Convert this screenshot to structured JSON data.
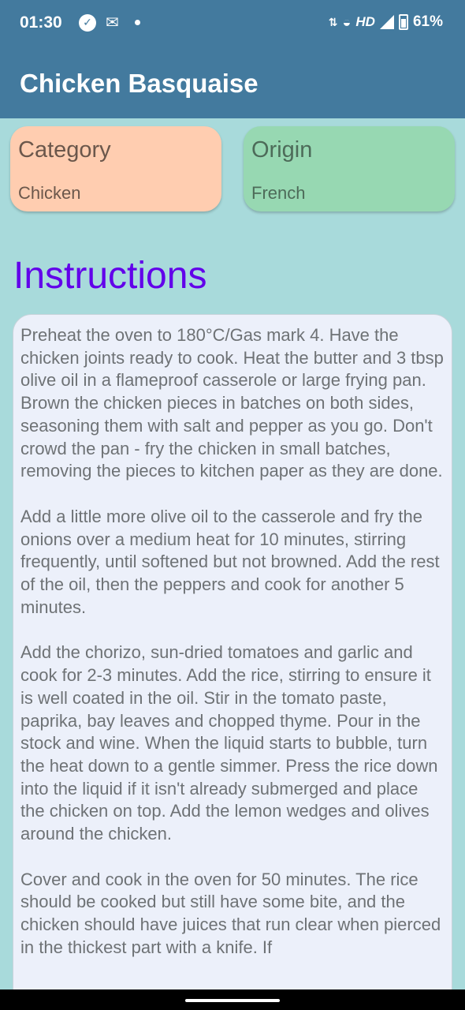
{
  "status_bar": {
    "time": "01:30",
    "left_icons": [
      "notification-icon",
      "gmail-icon",
      "dot-icon"
    ],
    "network": "HD",
    "battery": "61%"
  },
  "app_bar": {
    "title": "Chicken Basquaise"
  },
  "category_card": {
    "label": "Category",
    "value": "Chicken",
    "color": "#ffcdb0"
  },
  "origin_card": {
    "label": "Origin",
    "value": "French",
    "color": "#97d8b2"
  },
  "instructions": {
    "title": "Instructions",
    "title_color": "#6200ea",
    "paragraphs": [
      "Preheat the oven to 180°C/Gas mark 4. Have the chicken joints ready to cook. Heat the butter and 3 tbsp olive oil in a flameproof casserole or large frying pan. Brown the chicken pieces in batches on both sides, seasoning them with salt and pepper as you go. Don't crowd the pan - fry the chicken in small batches, removing the pieces to kitchen paper as they are done.",
      "Add a little more olive oil to the casserole and fry the onions over a medium heat for 10 minutes, stirring frequently, until softened but not browned. Add the rest of the oil, then the peppers and cook for another 5 minutes.",
      "Add the chorizo, sun-dried tomatoes and garlic and cook for 2-3 minutes. Add the rice, stirring to ensure it is well coated in the oil. Stir in the tomato paste, paprika, bay leaves and chopped thyme. Pour in the stock and wine. When the liquid starts to bubble, turn the heat down to a gentle simmer. Press the rice down into the liquid if it isn't already submerged and place the chicken on top. Add the lemon wedges and olives around the chicken.",
      "Cover and cook in the oven for 50 minutes. The rice should be cooked but still have some bite, and the chicken should have juices that run clear when pierced in the thickest part with a knife. If"
    ]
  },
  "colors": {
    "app_bar": "#437a9e",
    "background": "#a8dadb",
    "instructions_bg": "#ecf0fa"
  }
}
